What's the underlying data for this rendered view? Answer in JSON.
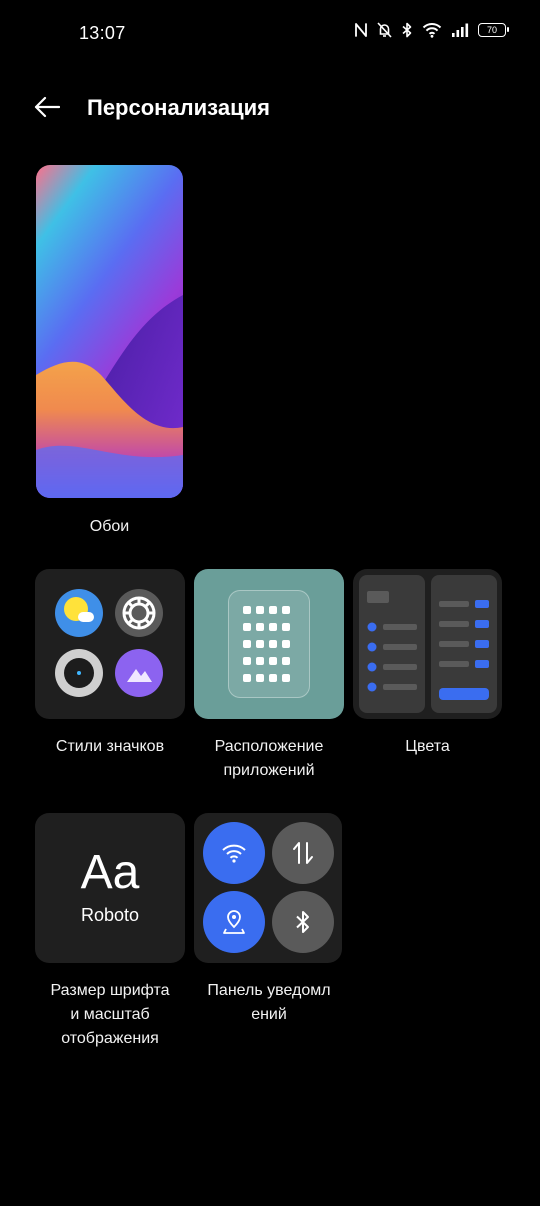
{
  "status_bar": {
    "time": "13:07",
    "battery_level": "70",
    "icons": [
      "nfc-icon",
      "bell-muted-icon",
      "bluetooth-icon",
      "wifi-icon",
      "signal-icon",
      "battery-icon"
    ]
  },
  "header": {
    "title": "Персонализация",
    "back_icon": "arrow-left-icon"
  },
  "wallpaper": {
    "label": "Обои"
  },
  "tiles": {
    "icon_styles": {
      "label": "Стили значков"
    },
    "app_layout": {
      "label_line1": "Расположение",
      "label_line2": "приложений"
    },
    "colors": {
      "label": "Цвета"
    },
    "font": {
      "sample": "Aa",
      "font_name": "Roboto",
      "label_line1": "Размер шрифта",
      "label_line2": "и масштаб",
      "label_line3": "отображения"
    },
    "notification_panel": {
      "label_line1": "Панель уведомл",
      "label_line2": "ений"
    }
  },
  "colors": {
    "background": "#000000",
    "tile_bg": "#1f1f1f",
    "accent_blue": "#3a6df0",
    "teal": "#6a9e99"
  }
}
